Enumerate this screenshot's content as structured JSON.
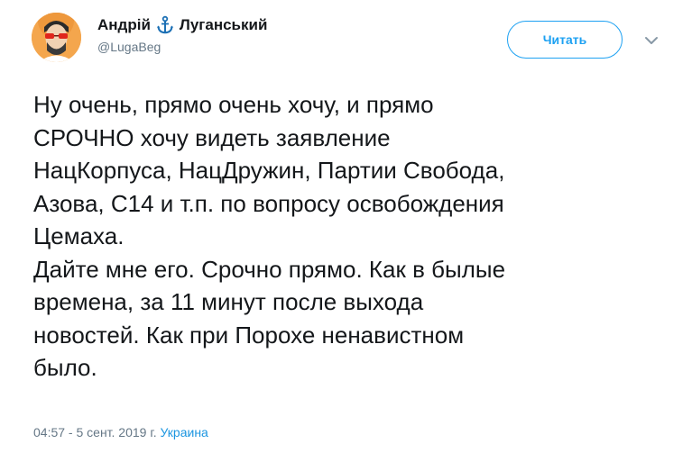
{
  "author": {
    "display_name_first": "Андрій",
    "display_name_last": "Луганський",
    "name_emoji_icon": "anchor-icon",
    "handle": "@LugaBeg",
    "avatar_icon": "avatar-portrait"
  },
  "actions": {
    "follow_label": "Читать",
    "more_icon": "chevron-down-icon"
  },
  "tweet": {
    "text": "Ну очень, прямо очень хочу, и прямо\nСРОЧНО хочу видеть заявление\nНацКорпуса, НацДружин, Партии Свобода,\nАзова, С14 и т.п. по вопросу освобождения\nЦемаха.\nДайте мне его. Срочно прямо. Как в былые\nвремена, за 11 минут после выхода\nновостей. Как при Порохе ненавистном\nбыло."
  },
  "meta": {
    "timestamp": "04:57 - 5 сент. 2019 г.",
    "location": "Украина"
  },
  "colors": {
    "accent": "#1da1f2",
    "secondary_text": "#657786",
    "primary_text": "#14171a",
    "location_link": "#1b95e0"
  }
}
